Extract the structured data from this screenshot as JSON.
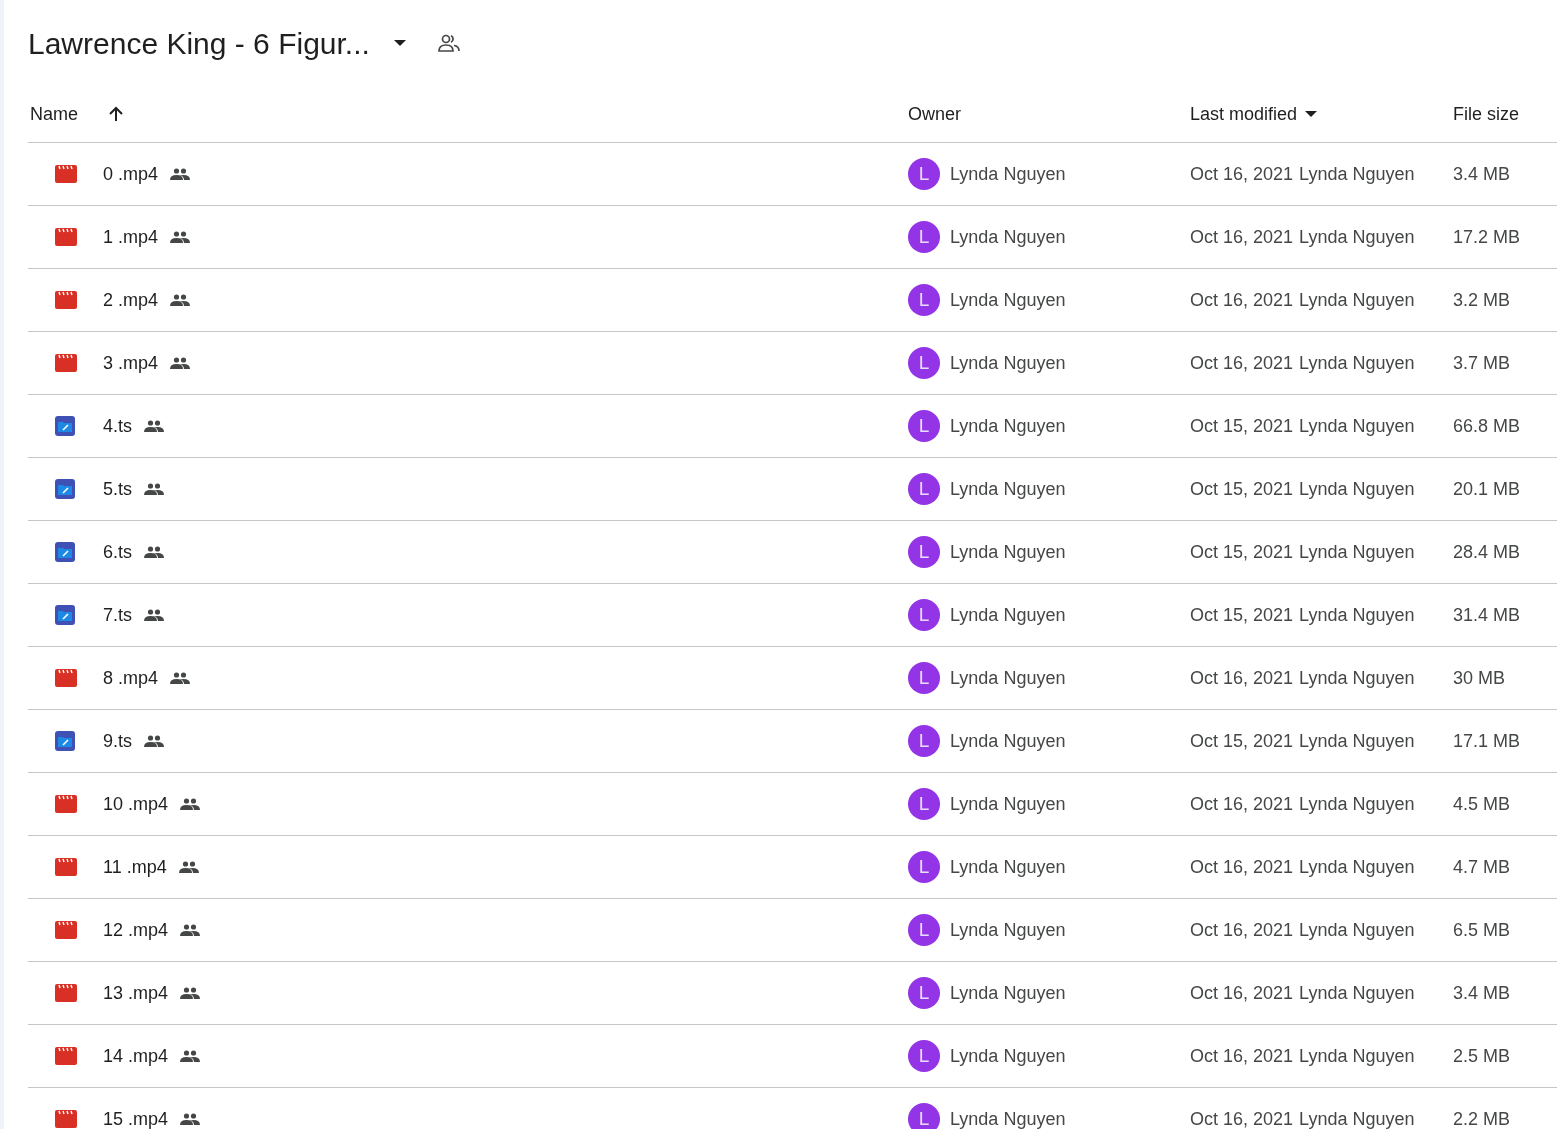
{
  "folder": {
    "title": "Lawrence King - 6 Figur..."
  },
  "columns": {
    "name": "Name",
    "owner": "Owner",
    "modified": "Last modified",
    "size": "File size"
  },
  "rows": [
    {
      "name": "0 .mp4",
      "kind": "video",
      "owner_initial": "L",
      "owner": "Lynda Nguyen",
      "modified": "Oct 16, 2021",
      "modified_by": "Lynda Nguyen",
      "size": "3.4 MB"
    },
    {
      "name": "1 .mp4",
      "kind": "video",
      "owner_initial": "L",
      "owner": "Lynda Nguyen",
      "modified": "Oct 16, 2021",
      "modified_by": "Lynda Nguyen",
      "size": "17.2 MB"
    },
    {
      "name": "2 .mp4",
      "kind": "video",
      "owner_initial": "L",
      "owner": "Lynda Nguyen",
      "modified": "Oct 16, 2021",
      "modified_by": "Lynda Nguyen",
      "size": "3.2 MB"
    },
    {
      "name": "3 .mp4",
      "kind": "video",
      "owner_initial": "L",
      "owner": "Lynda Nguyen",
      "modified": "Oct 16, 2021",
      "modified_by": "Lynda Nguyen",
      "size": "3.7 MB"
    },
    {
      "name": "4.ts",
      "kind": "ts",
      "owner_initial": "L",
      "owner": "Lynda Nguyen",
      "modified": "Oct 15, 2021",
      "modified_by": "Lynda Nguyen",
      "size": "66.8 MB"
    },
    {
      "name": "5.ts",
      "kind": "ts",
      "owner_initial": "L",
      "owner": "Lynda Nguyen",
      "modified": "Oct 15, 2021",
      "modified_by": "Lynda Nguyen",
      "size": "20.1 MB"
    },
    {
      "name": "6.ts",
      "kind": "ts",
      "owner_initial": "L",
      "owner": "Lynda Nguyen",
      "modified": "Oct 15, 2021",
      "modified_by": "Lynda Nguyen",
      "size": "28.4 MB"
    },
    {
      "name": "7.ts",
      "kind": "ts",
      "owner_initial": "L",
      "owner": "Lynda Nguyen",
      "modified": "Oct 15, 2021",
      "modified_by": "Lynda Nguyen",
      "size": "31.4 MB"
    },
    {
      "name": "8 .mp4",
      "kind": "video",
      "owner_initial": "L",
      "owner": "Lynda Nguyen",
      "modified": "Oct 16, 2021",
      "modified_by": "Lynda Nguyen",
      "size": "30 MB"
    },
    {
      "name": "9.ts",
      "kind": "ts",
      "owner_initial": "L",
      "owner": "Lynda Nguyen",
      "modified": "Oct 15, 2021",
      "modified_by": "Lynda Nguyen",
      "size": "17.1 MB"
    },
    {
      "name": "10 .mp4",
      "kind": "video",
      "owner_initial": "L",
      "owner": "Lynda Nguyen",
      "modified": "Oct 16, 2021",
      "modified_by": "Lynda Nguyen",
      "size": "4.5 MB"
    },
    {
      "name": "11 .mp4",
      "kind": "video",
      "owner_initial": "L",
      "owner": "Lynda Nguyen",
      "modified": "Oct 16, 2021",
      "modified_by": "Lynda Nguyen",
      "size": "4.7 MB"
    },
    {
      "name": "12 .mp4",
      "kind": "video",
      "owner_initial": "L",
      "owner": "Lynda Nguyen",
      "modified": "Oct 16, 2021",
      "modified_by": "Lynda Nguyen",
      "size": "6.5 MB"
    },
    {
      "name": "13 .mp4",
      "kind": "video",
      "owner_initial": "L",
      "owner": "Lynda Nguyen",
      "modified": "Oct 16, 2021",
      "modified_by": "Lynda Nguyen",
      "size": "3.4 MB"
    },
    {
      "name": "14 .mp4",
      "kind": "video",
      "owner_initial": "L",
      "owner": "Lynda Nguyen",
      "modified": "Oct 16, 2021",
      "modified_by": "Lynda Nguyen",
      "size": "2.5 MB"
    },
    {
      "name": "15 .mp4",
      "kind": "video",
      "owner_initial": "L",
      "owner": "Lynda Nguyen",
      "modified": "Oct 16, 2021",
      "modified_by": "Lynda Nguyen",
      "size": "2.2 MB"
    }
  ]
}
